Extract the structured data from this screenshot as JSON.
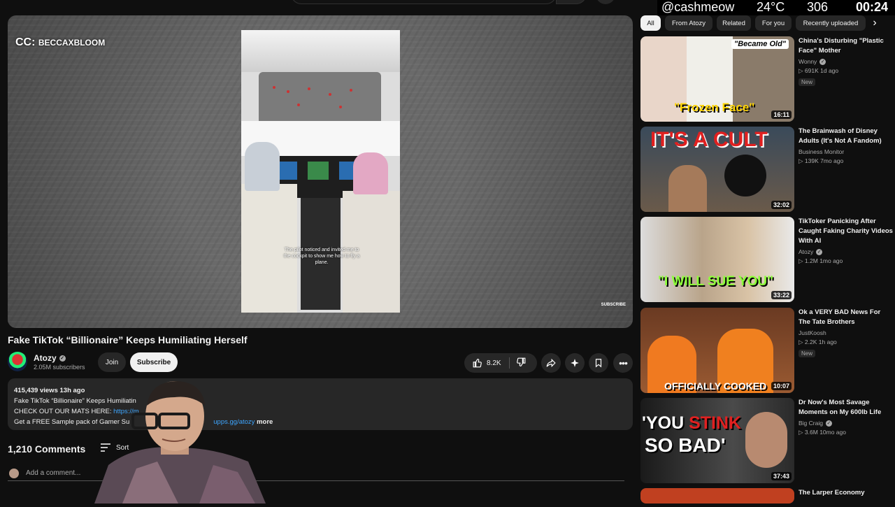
{
  "overlay": {
    "handle": "@cashmeow",
    "temp": "24°C",
    "count": "306",
    "time": "00:24"
  },
  "player": {
    "credit_prefix": "CC:",
    "credit_name": "BECCAXBLOOM",
    "caption": "The pilot noticed and invited me to the cockpit to show me how to fly a plane.",
    "subscribe_watermark": "SUBSCRIBE"
  },
  "video": {
    "title": "Fake TikTok “Billionaire” Keeps Humiliating Herself",
    "channel": "Atozy",
    "subscribers": "2.05M subscribers",
    "join_label": "Join",
    "subscribe_label": "Subscribe",
    "likes": "8.2K"
  },
  "description": {
    "meta": "415,439 views  13h ago",
    "line1": "Fake TikTok “Billionaire” Keeps Humiliatin",
    "line2_prefix": "CHECK OUT OUR MATS HERE: ",
    "line2_link": "https://m",
    "line3_prefix": "Get a FREE Sample pack of Gamer Su",
    "line3_link": "upps.gg/atozy",
    "more": "more"
  },
  "comments": {
    "count": "1,210 Comments",
    "sort_label": "Sort",
    "placeholder": "Add a comment..."
  },
  "chips": [
    {
      "label": "All"
    },
    {
      "label": "From Atozy"
    },
    {
      "label": "Related"
    },
    {
      "label": "For you"
    },
    {
      "label": "Recently uploaded"
    }
  ],
  "recommendations": [
    {
      "title": "China's Disturbing \"Plastic Face\" Mother",
      "channel": "Wonny",
      "views": "691K",
      "age": "1d ago",
      "duration": "16:11",
      "badge": "New",
      "thumb_top": "\"Became Old\"",
      "thumb_bottom": "\"Frozen Face\""
    },
    {
      "title": "The Brainwash of Disney Adults (It's Not A Fandom)",
      "channel": "Business Monitor",
      "views": "139K",
      "age": "7mo ago",
      "duration": "32:02",
      "thumb_top": "IT'S A CULT"
    },
    {
      "title": "TikToker Panicking After Caught Faking Charity Videos With AI",
      "channel": "Atozy",
      "views": "1.2M",
      "age": "1mo ago",
      "duration": "33:22",
      "thumb_bottom": "\"I WILL SUE YOU\""
    },
    {
      "title": "Ok a VERY BAD News For The Tate Brothers",
      "channel": "JustKoosh",
      "views": "2.2K",
      "age": "1h ago",
      "duration": "10:07",
      "badge": "New",
      "thumb_bottom": "OFFICIALLY COOKED"
    },
    {
      "title": "Dr Now's Most Savage Moments on My 600lb Life",
      "channel": "Big Craig",
      "views": "3.6M",
      "age": "10mo ago",
      "duration": "37:43",
      "thumb_top_a": "'YOU ",
      "thumb_top_b": "STINK",
      "thumb_bottom": "SO BAD'"
    },
    {
      "title": "The Larper Economy"
    }
  ]
}
